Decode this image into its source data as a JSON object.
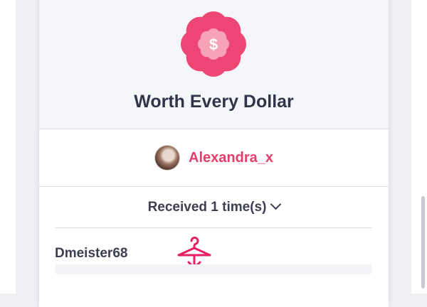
{
  "badge": {
    "icon": "dollar-rosette-icon",
    "symbol": "$",
    "color": "#ee4674",
    "inner_color": "#f7a3b6"
  },
  "title": "Worth Every Dollar",
  "sender": {
    "avatar": "avatar",
    "name": "Alexandra_x",
    "name_color": "#e33d6b"
  },
  "received": {
    "label": "Received 1 time(s)",
    "icon": "chevron-down-icon"
  },
  "givers": [
    {
      "name": "Dmeister68",
      "icon": "hanger-icon"
    }
  ],
  "accent_color": "#e91e63"
}
